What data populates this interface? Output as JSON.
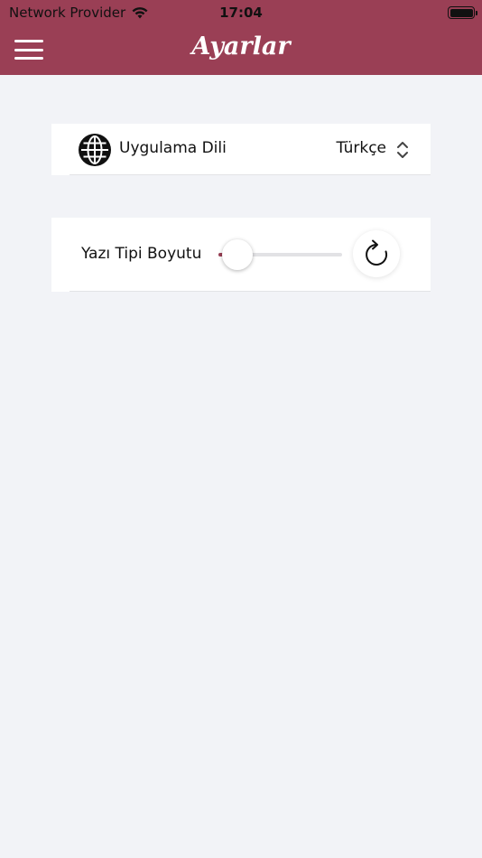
{
  "status_bar": {
    "carrier": "Network Provider",
    "time": "17:04",
    "wifi_icon": "wifi-icon",
    "battery_icon": "battery-icon"
  },
  "header": {
    "title": "Ayarlar",
    "menu_icon": "hamburger-menu-icon",
    "background_color": "#9a3f55"
  },
  "settings": {
    "language": {
      "icon": "globe-icon",
      "label": "Uygulama Dili",
      "value": "Türkçe",
      "selector_icon": "chevron-up-down-icon"
    },
    "font_size": {
      "label": "Yazı Tipi Boyutu",
      "slider_level": 0.15,
      "reset_icon": "refresh-icon",
      "accent_color": "#9a3f55"
    }
  }
}
